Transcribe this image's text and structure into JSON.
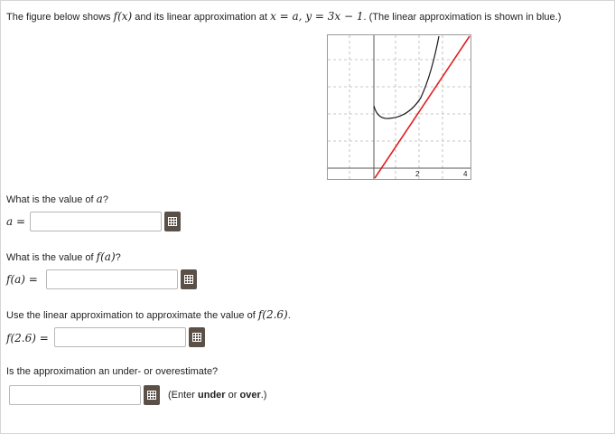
{
  "intro": {
    "part1": "The figure below shows ",
    "fx": "f(x)",
    "part2": " and its linear approximation at ",
    "cond": "x = a, y = 3x − 1",
    "part3": ". (The linear approximation is shown in blue.)"
  },
  "graph": {
    "tick_2": "2",
    "tick_4": "4",
    "colors": {
      "curve": "#1a1a1a",
      "tangent": "#e02020",
      "grid": "#b0b0b0",
      "axis": "#555555"
    }
  },
  "q1": {
    "prompt": "What is the value of ",
    "var": "a",
    "qmark": "?",
    "label": "a =",
    "value": ""
  },
  "q2": {
    "prompt": "What is the value of ",
    "expr": "f(a)",
    "qmark": "?",
    "label": "f(a) =",
    "value": ""
  },
  "q3": {
    "prompt": "Use the linear approximation to approximate the value of ",
    "expr": "f(2.6)",
    "period": ".",
    "label": "f(2.6) =",
    "value": ""
  },
  "q4": {
    "prompt": "Is the approximation an under- or overestimate?",
    "value": "",
    "hint_open": "(Enter ",
    "hint_under": "under",
    "hint_or": " or ",
    "hint_over": "over",
    "hint_close": ".)"
  },
  "keyboard_icon": "keypad-icon"
}
